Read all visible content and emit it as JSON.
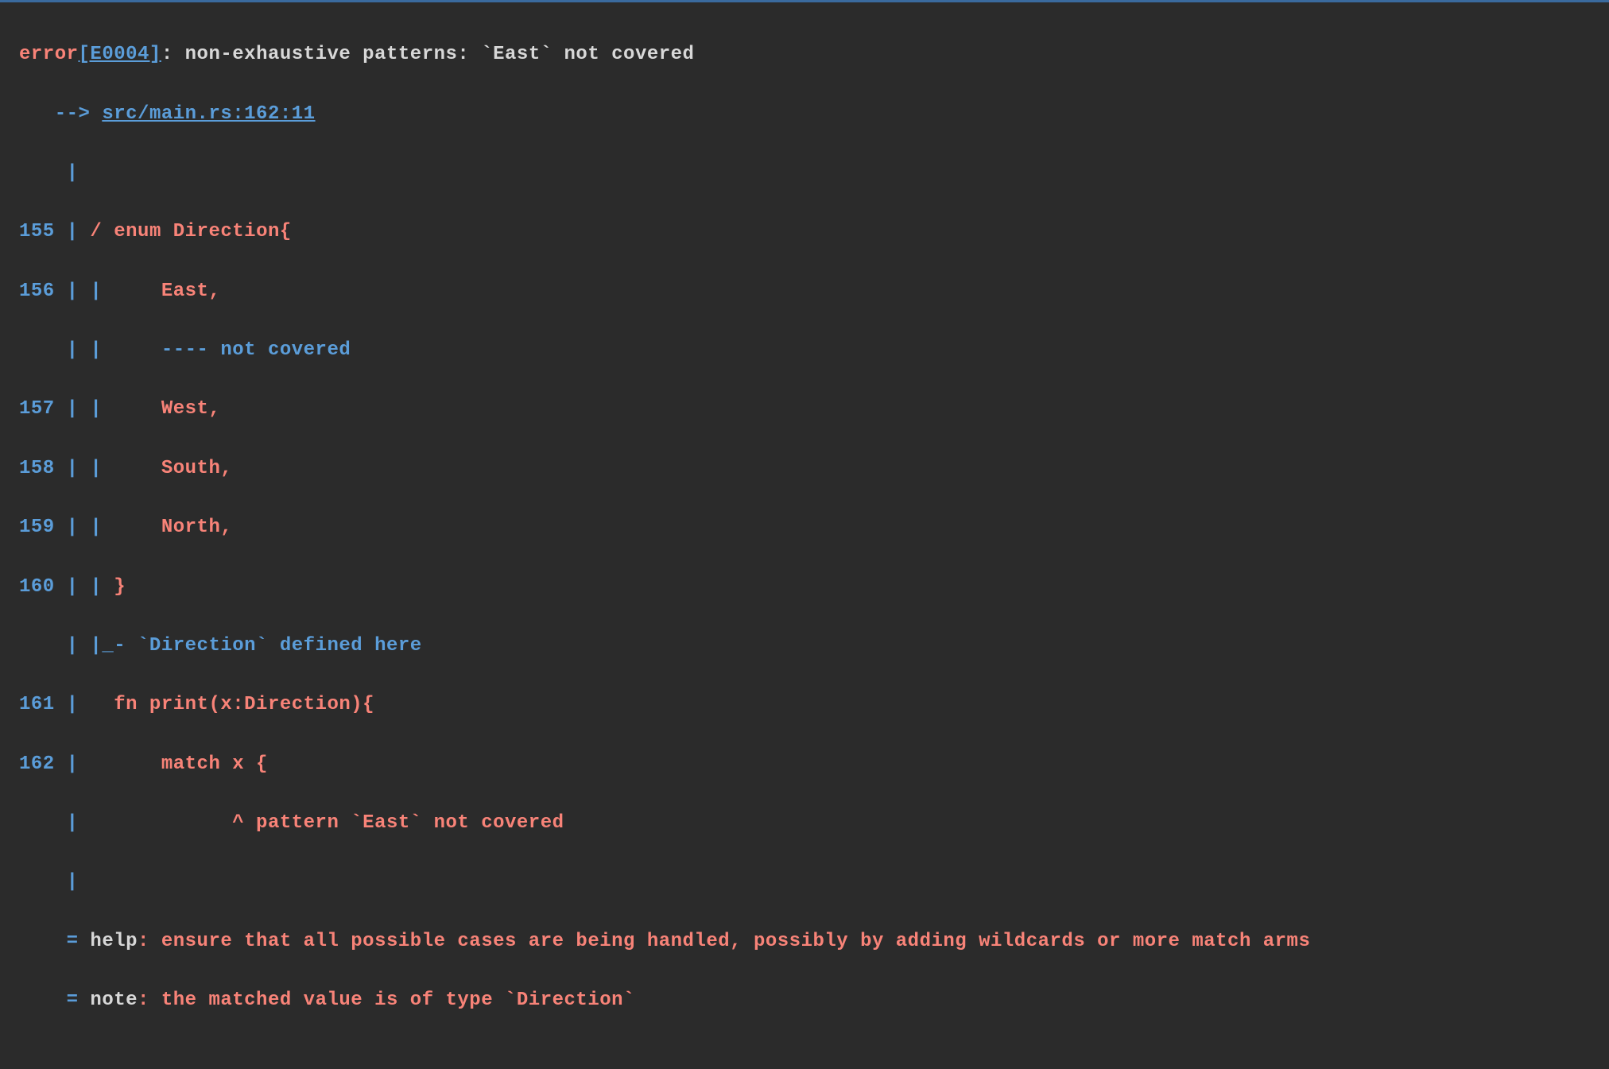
{
  "header": {
    "error_label": "error",
    "error_code": "[E0004]",
    "error_message": ": non-exhaustive patterns: `East` not covered"
  },
  "arrow": {
    "prefix": "   --> ",
    "location": "src/main.rs:162:11"
  },
  "gutter_empty": "    |",
  "lines": {
    "l155": {
      "num": "155 ",
      "pipe": "| ",
      "slash": "/ ",
      "code": "enum Direction{"
    },
    "l156": {
      "num": "156 ",
      "pipe": "| | ",
      "code": "    East,"
    },
    "l_note1": {
      "num": "    ",
      "pipe": "| | ",
      "text": "    ---- not covered"
    },
    "l157": {
      "num": "157 ",
      "pipe": "| | ",
      "code": "    West,"
    },
    "l158": {
      "num": "158 ",
      "pipe": "| | ",
      "code": "    South,"
    },
    "l159": {
      "num": "159 ",
      "pipe": "| | ",
      "code": "    North,"
    },
    "l160": {
      "num": "160 ",
      "pipe": "| | ",
      "code": "}"
    },
    "l_note2": {
      "num": "    ",
      "pipe": "| |_",
      "dash": "- ",
      "text": "`Direction` defined here"
    },
    "l161": {
      "num": "161 ",
      "pipe": "|   ",
      "code": "fn print(x:Direction){"
    },
    "l162": {
      "num": "162 ",
      "pipe": "|   ",
      "code": "    match x {"
    },
    "l_note3": {
      "num": "    ",
      "pipe": "|   ",
      "caret": "          ^ ",
      "text": "pattern `East` not covered"
    },
    "l_empty2": {
      "num": "    ",
      "pipe": "|"
    }
  },
  "footer": {
    "help_eq": "    = ",
    "help_label": "help",
    "help_text": ": ensure that all possible cases are being handled, possibly by adding wildcards or more match arms",
    "note_eq": "    = ",
    "note_label": "note",
    "note_text": ": the matched value is of type `Direction`"
  }
}
